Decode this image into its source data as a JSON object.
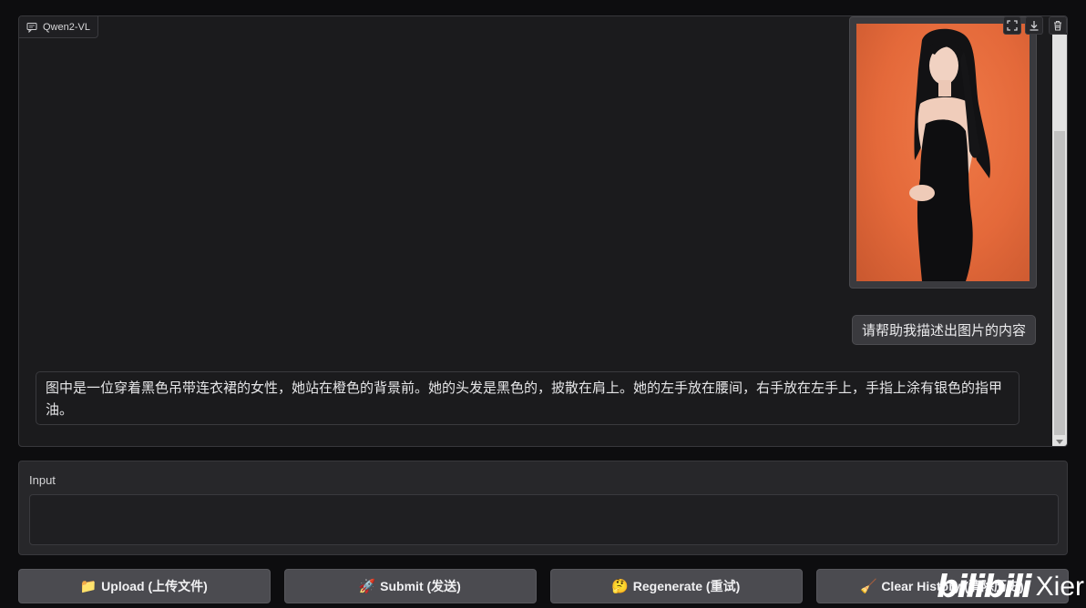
{
  "chatbot": {
    "label": "Qwen2-VL",
    "user_message": "请帮助我描述出图片的内容",
    "bot_message": "图中是一位穿着黑色吊带连衣裙的女性，她站在橙色的背景前。她的头发是黑色的，披散在肩上。她的左手放在腰间，右手放在左手上，手指上涂有银色的指甲油。",
    "image_alt": "woman in black slip dress against orange background",
    "icons": [
      "chat-icon",
      "fullscreen-icon",
      "download-icon",
      "trash-icon"
    ]
  },
  "input": {
    "label": "Input",
    "value": "",
    "placeholder": ""
  },
  "buttons": {
    "upload": {
      "emoji": "📁",
      "label": "Upload (上传文件)"
    },
    "submit": {
      "emoji": "🚀",
      "label": "Submit (发送)"
    },
    "regenerate": {
      "emoji": "🤔",
      "label": "Regenerate (重试)"
    },
    "clear": {
      "emoji": "🧹",
      "label": "Clear History (清除历史)"
    }
  },
  "watermark": {
    "logo": "bilibili",
    "text": "Xier"
  },
  "colors": {
    "background": "#0d0d0f",
    "panel": "#1b1b1d",
    "button": "#4b4b50",
    "photo_bg": "#e4693a"
  }
}
